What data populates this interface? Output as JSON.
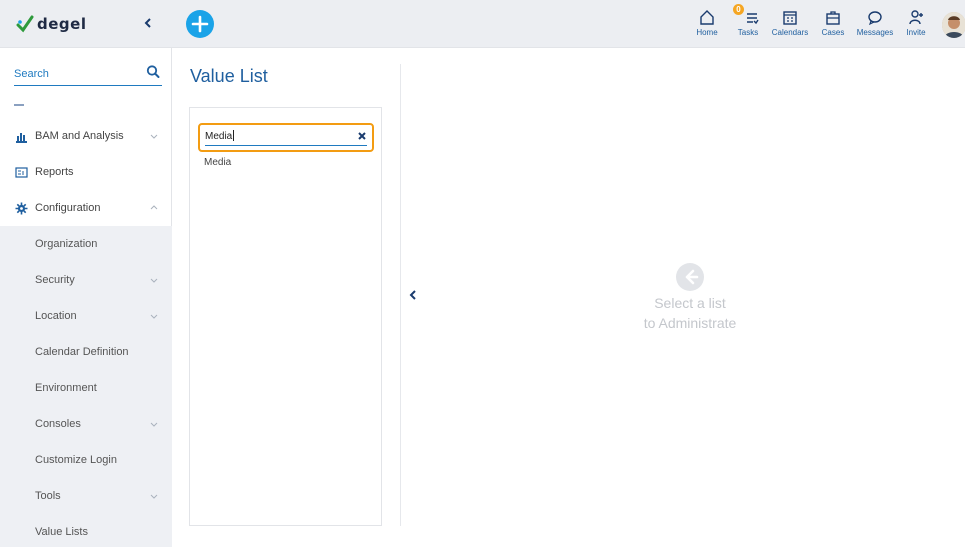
{
  "header": {
    "logo_text": "degel",
    "actions": [
      {
        "label": "Home",
        "icon": "home-icon"
      },
      {
        "label": "Tasks",
        "icon": "tasks-icon",
        "badge": "0"
      },
      {
        "label": "Calendars",
        "icon": "calendar-icon"
      },
      {
        "label": "Cases",
        "icon": "briefcase-icon"
      },
      {
        "label": "Messages",
        "icon": "chat-bubble-icon"
      },
      {
        "label": "Invite",
        "icon": "add-user-icon"
      }
    ]
  },
  "sidebar": {
    "search_label": "Search",
    "items": [
      {
        "label": "BAM and Analysis",
        "icon": "bar-chart-icon"
      },
      {
        "label": "Reports",
        "icon": "report-icon"
      },
      {
        "label": "Configuration",
        "icon": "gear-icon"
      }
    ],
    "sub_items": [
      {
        "label": "Organization"
      },
      {
        "label": "Security"
      },
      {
        "label": "Location"
      },
      {
        "label": "Calendar Definition"
      },
      {
        "label": "Environment"
      },
      {
        "label": "Consoles"
      },
      {
        "label": "Customize Login"
      },
      {
        "label": "Tools"
      },
      {
        "label": "Value Lists"
      }
    ]
  },
  "main": {
    "title": "Value List",
    "filter_value": "Media",
    "results": [
      "Media"
    ],
    "empty_state_line1": "Select a list",
    "empty_state_line2": "to Administrate"
  },
  "colors": {
    "accent": "#1aa3e8",
    "brand_blue": "#1f5f9f",
    "highlight": "#f39c12"
  }
}
